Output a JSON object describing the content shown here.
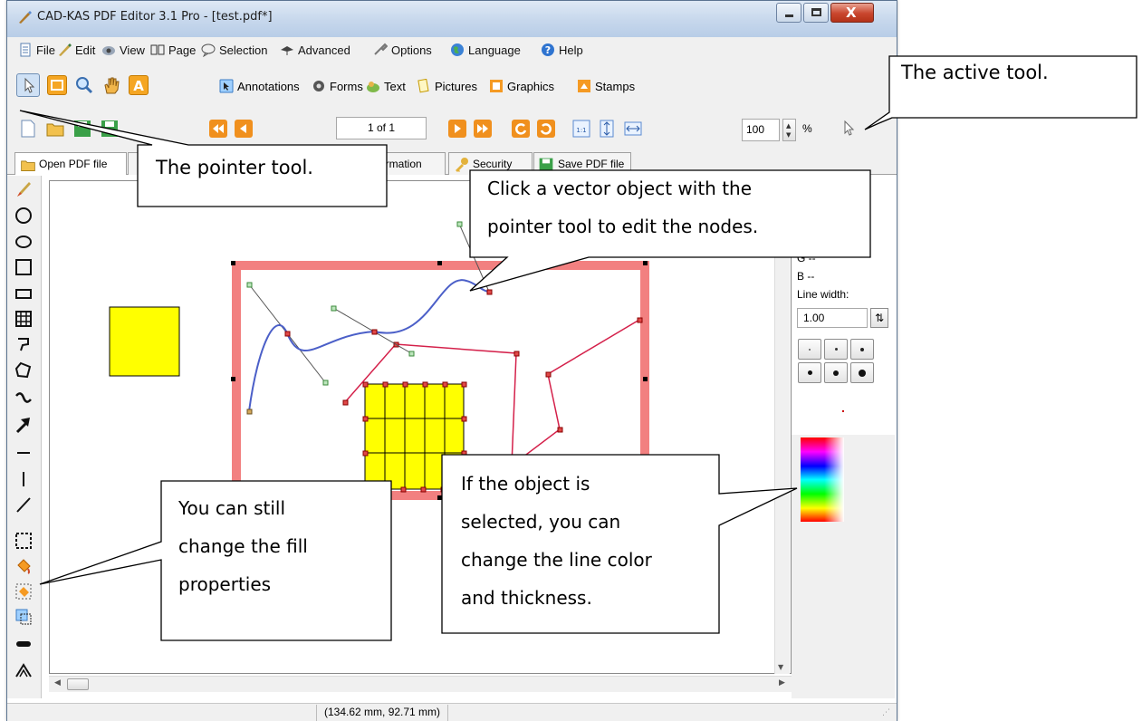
{
  "window": {
    "title": "CAD-KAS PDF Editor 3.1 Pro - [test.pdf*]"
  },
  "menu": [
    {
      "label": "File",
      "icon": "file-icon"
    },
    {
      "label": "Edit",
      "icon": "edit-icon"
    },
    {
      "label": "View",
      "icon": "view-icon"
    },
    {
      "label": "Page",
      "icon": "page-icon"
    },
    {
      "label": "Selection",
      "icon": "selection-icon"
    },
    {
      "label": "Advanced",
      "icon": "advanced-icon"
    },
    {
      "label": "Options",
      "icon": "options-icon"
    },
    {
      "label": "Language",
      "icon": "language-icon"
    },
    {
      "label": "Help",
      "icon": "help-icon"
    }
  ],
  "toolbar1": {
    "annotations": "Annotations",
    "forms": "Forms",
    "text": "Text",
    "pictures": "Pictures",
    "graphics": "Graphics",
    "stamps": "Stamps"
  },
  "toolbar2": {
    "page_indicator": "1 of 1",
    "zoom_value": "100",
    "zoom_unit": "%"
  },
  "tabs": {
    "open": "Open PDF file",
    "information": "nformation",
    "security": "Security",
    "save": "Save PDF file"
  },
  "properties": {
    "g_value": "G --",
    "b_value": "B --",
    "line_width_label": "Line width:",
    "line_width_value": "1.00"
  },
  "status": {
    "coordinates": "(134.62 mm, 92.71 mm)"
  },
  "callouts": {
    "active_tool": "The active tool.",
    "pointer_tool": "The pointer tool.",
    "vector_line1": "Click a vector object with the",
    "vector_line2": "pointer tool to edit the nodes.",
    "fill_line1": "You can still",
    "fill_line2": "change the fill",
    "fill_line3": "properties",
    "selected_line1": "If the object is",
    "selected_line2": "selected, you can",
    "selected_line3": "change the line color",
    "selected_line4": "and thickness."
  },
  "colors": {
    "accent_red": "#f28080",
    "fill_yellow": "#ffff00",
    "curve_blue": "#4b5fc8",
    "polyline_red": "#d4204a",
    "node_red": "#e04848",
    "node_green": "#4aa84a"
  }
}
